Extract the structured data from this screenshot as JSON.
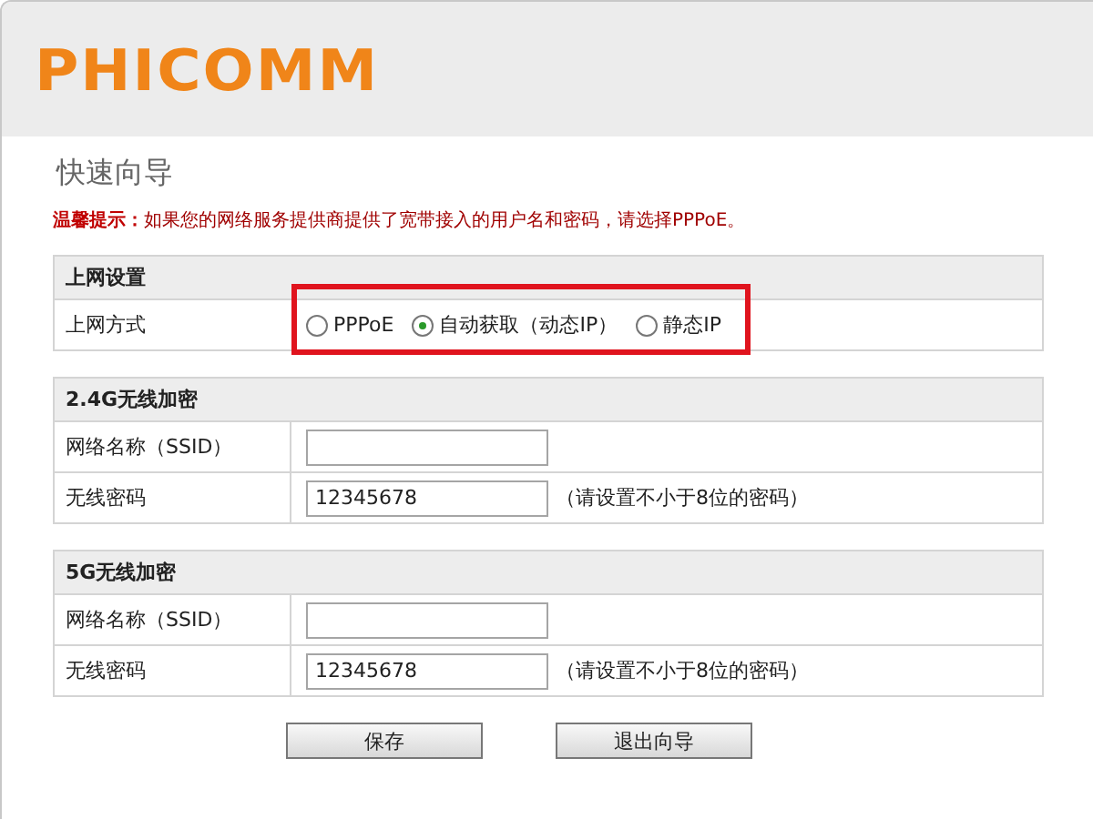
{
  "header": {
    "logo": "PHICOMM"
  },
  "title": "快速向导",
  "notice": "**温馨提示：**如果您的网络服务提供商提供了宽带接入的用户名和密码，请选择PPPoE。",
  "sections": [
    {
      "title": "上网设置",
      "rows": [
        {
          "kind": "radio",
          "label": "上网方式",
          "highlighted": true,
          "options": [
            {
              "label": "PPPoE",
              "selected": false
            },
            {
              "label": "自动获取（动态IP）",
              "selected": true
            },
            {
              "label": "静态IP",
              "selected": false
            }
          ]
        }
      ]
    },
    {
      "title": "2.4G无线加密",
      "rows": [
        {
          "kind": "field",
          "label": "网络名称（SSID）"
        },
        {
          "kind": "field",
          "label": "无线密码",
          "value": "12345678",
          "hint": "（请设置不小于8位的密码）"
        }
      ]
    },
    {
      "title": "5G无线加密",
      "rows": [
        {
          "kind": "field",
          "label": "网络名称（SSID）"
        },
        {
          "kind": "field",
          "label": "无线密码",
          "value": "12345678",
          "hint": "（请设置不小于8位的密码）"
        }
      ]
    }
  ],
  "buttons": [
    "保存",
    "退出向导"
  ]
}
